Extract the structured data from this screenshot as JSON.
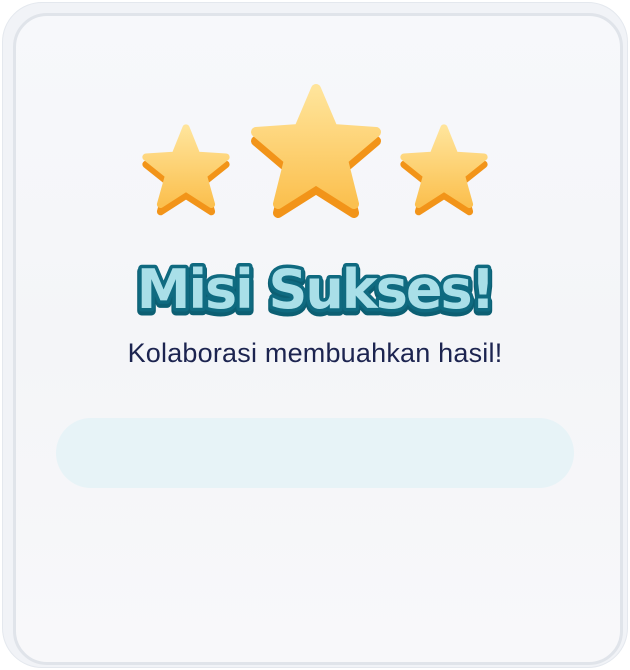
{
  "result": {
    "title": "Misi Sukses!",
    "subtitle": "Kolaborasi membuahkan hasil!",
    "stars_earned": 3,
    "stars_total": 3
  },
  "colors": {
    "title_fill": "#a7dde6",
    "title_stroke": "#0f6a80",
    "subtitle": "#1c2450",
    "star_top": "#ffe08c",
    "star_bottom": "#fbc55a",
    "star_shadow": "#f5961f",
    "bar": "#e7f3f7"
  },
  "icons": [
    "star-icon"
  ]
}
